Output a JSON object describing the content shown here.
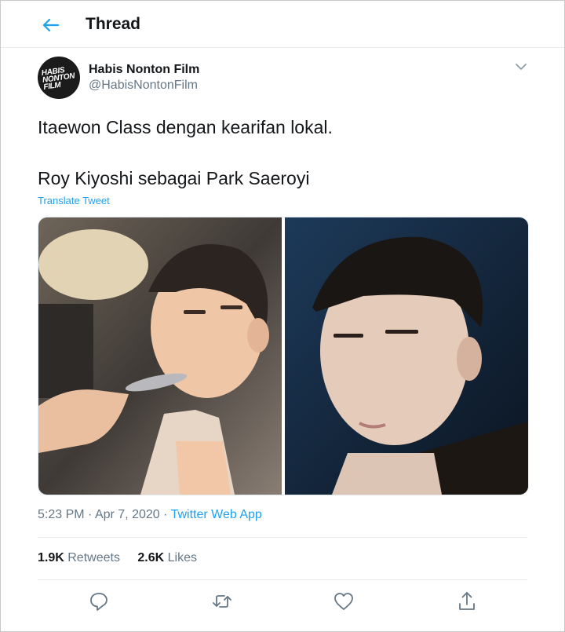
{
  "header": {
    "title": "Thread",
    "back_icon": "arrow-left-icon"
  },
  "tweet": {
    "avatar_logo_lines": [
      "HABIS",
      "NONTON",
      "FILM"
    ],
    "display_name": "Habis Nonton Film",
    "handle": "@HabisNontonFilm",
    "menu_icon": "chevron-down-icon",
    "text_line1": "Itaewon Class dengan kearifan lokal.",
    "text_line2": "Roy Kiyoshi sebagai Park Saeroyi",
    "translate_label": "Translate Tweet",
    "time": "5:23 PM",
    "date": "Apr 7, 2020",
    "separator": "·",
    "source_app": "Twitter Web App",
    "retweets_count": "1.9K",
    "retweets_label": "Retweets",
    "likes_count": "2.6K",
    "likes_label": "Likes"
  },
  "actions": [
    {
      "name": "reply",
      "icon": "reply-icon"
    },
    {
      "name": "retweet",
      "icon": "retweet-icon"
    },
    {
      "name": "like",
      "icon": "heart-icon"
    },
    {
      "name": "share",
      "icon": "share-icon"
    }
  ],
  "colors": {
    "accent": "#1da1f2",
    "text": "#14171a",
    "muted": "#657786",
    "border": "#e6ecf0"
  }
}
